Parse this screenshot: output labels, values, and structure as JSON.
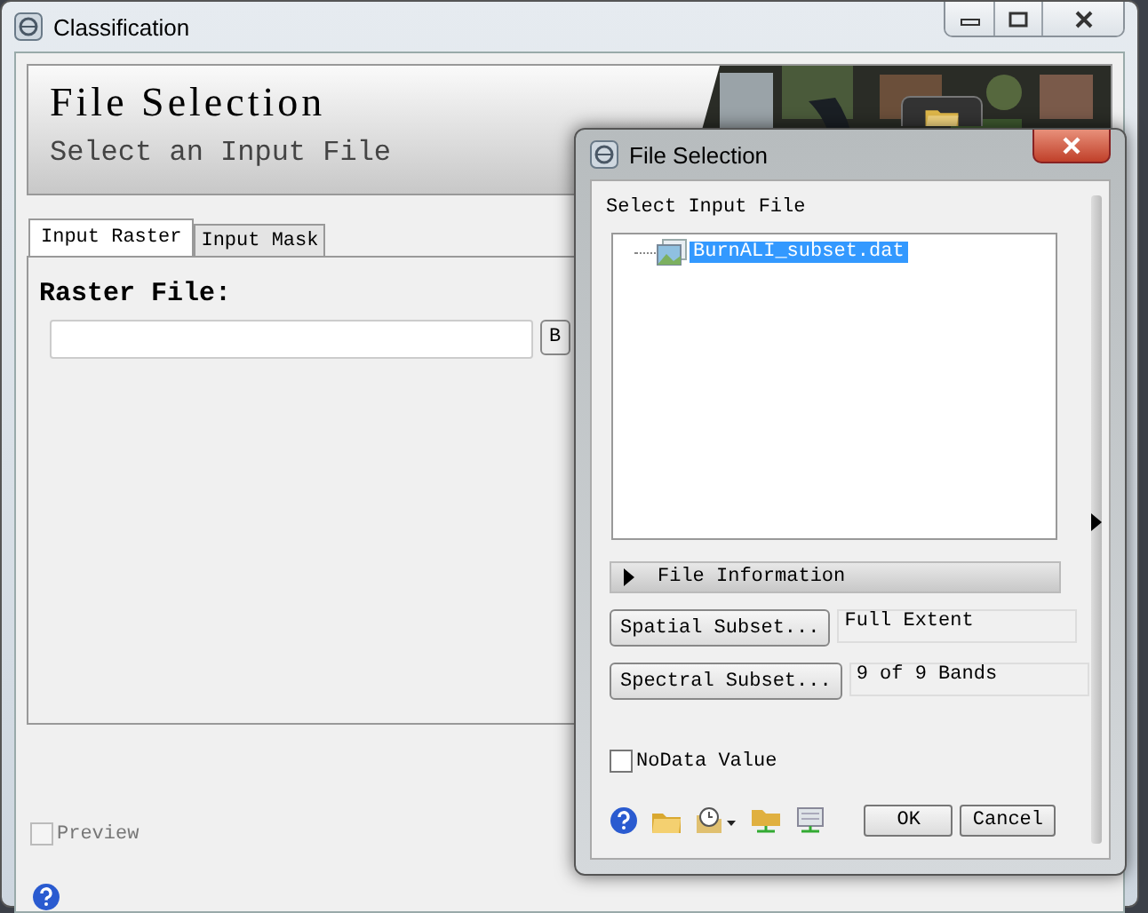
{
  "window": {
    "title": "Classification"
  },
  "header": {
    "title": "File Selection",
    "subtitle": "Select an Input File"
  },
  "tabs": [
    {
      "label": "Input Raster",
      "selected": true
    },
    {
      "label": "Input Mask",
      "selected": false
    }
  ],
  "raster_file": {
    "label": "Raster File:",
    "button": "B"
  },
  "preview": {
    "label": "Preview",
    "checked": false,
    "disabled": true
  },
  "dialog": {
    "title": "File Selection",
    "section_label": "Select Input File",
    "tree": [
      {
        "label": "BurnALI_subset.dat",
        "selected": true
      }
    ],
    "file_information": {
      "label": "File Information",
      "expanded": false
    },
    "subsets": [
      {
        "button": "Spatial Subset...",
        "value": "Full Extent"
      },
      {
        "button": "Spectral Subset...",
        "value": "9 of 9 Bands"
      }
    ],
    "nodata": {
      "label": "NoData Value",
      "checked": false
    },
    "buttons": [
      "OK",
      "Cancel"
    ]
  }
}
